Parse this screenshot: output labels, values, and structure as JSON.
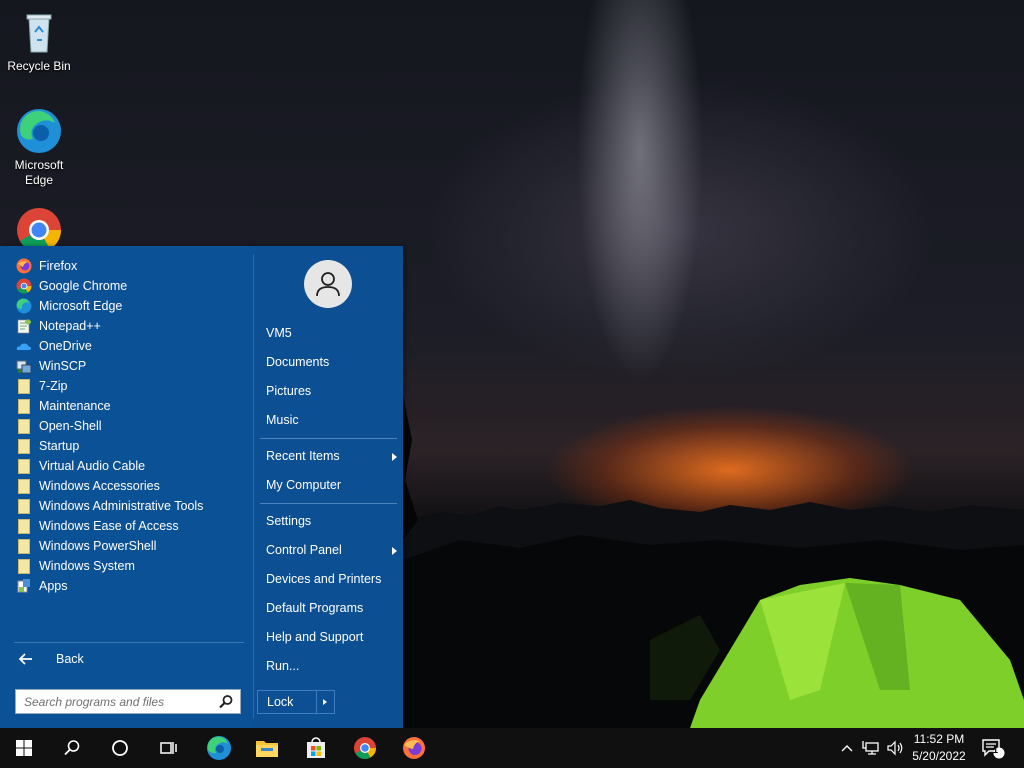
{
  "desktop": {
    "icons": [
      {
        "label": "Recycle Bin"
      },
      {
        "label": "Microsoft Edge"
      },
      {
        "label": ""
      }
    ]
  },
  "start_menu": {
    "programs": [
      {
        "label": "Firefox",
        "icon": "firefox-icon"
      },
      {
        "label": "Google Chrome",
        "icon": "chrome-icon"
      },
      {
        "label": "Microsoft Edge",
        "icon": "edge-icon"
      },
      {
        "label": "Notepad++",
        "icon": "notepad-plus-plus-icon"
      },
      {
        "label": "OneDrive",
        "icon": "onedrive-icon"
      },
      {
        "label": "WinSCP",
        "icon": "winscp-icon"
      },
      {
        "label": "7-Zip",
        "icon": "folder-icon"
      },
      {
        "label": "Maintenance",
        "icon": "folder-icon"
      },
      {
        "label": "Open-Shell",
        "icon": "folder-icon"
      },
      {
        "label": "Startup",
        "icon": "folder-icon"
      },
      {
        "label": "Virtual Audio Cable",
        "icon": "folder-icon"
      },
      {
        "label": "Windows Accessories",
        "icon": "folder-icon"
      },
      {
        "label": "Windows Administrative Tools",
        "icon": "folder-icon"
      },
      {
        "label": "Windows Ease of Access",
        "icon": "folder-icon"
      },
      {
        "label": "Windows PowerShell",
        "icon": "folder-icon"
      },
      {
        "label": "Windows System",
        "icon": "folder-icon"
      },
      {
        "label": "Apps",
        "icon": "apps-icon"
      }
    ],
    "back_label": "Back",
    "search_placeholder": "Search programs and files",
    "right_items": {
      "user": "VM5",
      "documents": "Documents",
      "pictures": "Pictures",
      "music": "Music",
      "recent_items": "Recent Items",
      "my_computer": "My Computer",
      "settings": "Settings",
      "control_panel": "Control Panel",
      "devices_printers": "Devices and Printers",
      "default_programs": "Default Programs",
      "help_support": "Help and Support",
      "run": "Run..."
    },
    "lock_label": "Lock"
  },
  "taskbar": {
    "time": "11:52 PM",
    "date": "5/20/2022",
    "notification_count": "1"
  },
  "colors": {
    "menu_bg": "#0b5196",
    "taskbar_bg": "#101010"
  }
}
